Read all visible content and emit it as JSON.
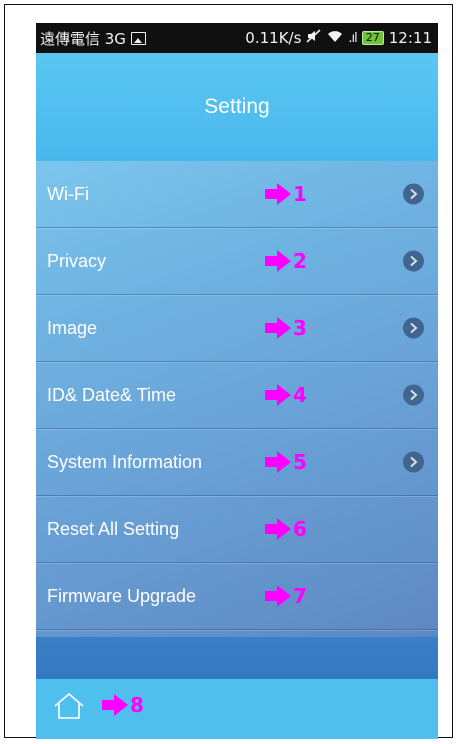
{
  "status_bar": {
    "carrier": "遠傳電信 3G",
    "speed": "0.11K/s",
    "battery": "27",
    "time": "12:11"
  },
  "header": {
    "title": "Setting"
  },
  "menu": {
    "items": [
      {
        "label": "Wi-Fi",
        "marker": "1",
        "has_chevron": true
      },
      {
        "label": "Privacy",
        "marker": "2",
        "has_chevron": true
      },
      {
        "label": "Image",
        "marker": "3",
        "has_chevron": true
      },
      {
        "label": "ID& Date& Time",
        "marker": "4",
        "has_chevron": true
      },
      {
        "label": "System Information",
        "marker": "5",
        "has_chevron": true
      },
      {
        "label": "Reset All Setting",
        "marker": "6",
        "has_chevron": false
      },
      {
        "label": "Firmware Upgrade",
        "marker": "7",
        "has_chevron": false
      }
    ]
  },
  "bottom_bar": {
    "home_icon": "home-icon",
    "marker": "8"
  },
  "colors": {
    "header": "#4fc0ee",
    "annotation": "#ff00ff",
    "chevron": "#40658f",
    "footer_band": "#3a80c6"
  }
}
